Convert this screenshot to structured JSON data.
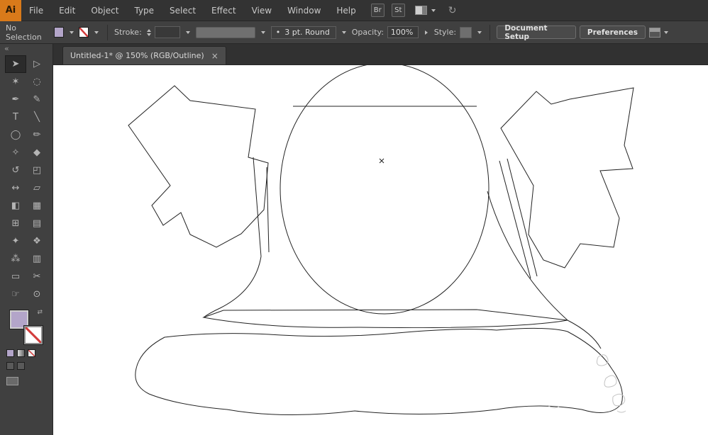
{
  "app": {
    "logo_text": "Ai"
  },
  "menubar": {
    "items": [
      "File",
      "Edit",
      "Object",
      "Type",
      "Select",
      "Effect",
      "View",
      "Window",
      "Help"
    ]
  },
  "topbar": {
    "br_label": "Br",
    "st_label": "St",
    "gesture_glyph": "↻"
  },
  "controlbar": {
    "selection_status": "No Selection",
    "stroke_label": "Stroke:",
    "brush_dot": "•",
    "brush_value": "3 pt. Round",
    "opacity_label": "Opacity:",
    "opacity_value": "100%",
    "style_label": "Style:",
    "document_setup_label": "Document Setup",
    "preferences_label": "Preferences"
  },
  "tabbar": {
    "active_tab": "Untitled-1* @ 150% (RGB/Outline)",
    "close_glyph": "×"
  },
  "toolbar": {
    "collapse_glyph": "«",
    "swap_glyph": "⇄"
  },
  "tools": [
    {
      "name": "selection-tool",
      "glyph": "➤"
    },
    {
      "name": "direct-selection-tool",
      "glyph": "▷"
    },
    {
      "name": "magic-wand-tool",
      "glyph": "✶"
    },
    {
      "name": "lasso-tool",
      "glyph": "◌"
    },
    {
      "name": "pen-tool",
      "glyph": "✒"
    },
    {
      "name": "pencil-tool",
      "glyph": "✎"
    },
    {
      "name": "type-tool",
      "glyph": "T"
    },
    {
      "name": "line-segment-tool",
      "glyph": "╲"
    },
    {
      "name": "ellipse-tool",
      "glyph": "◯"
    },
    {
      "name": "paintbrush-tool",
      "glyph": "✏"
    },
    {
      "name": "shaper-tool",
      "glyph": "✧"
    },
    {
      "name": "eraser-tool",
      "glyph": "◆"
    },
    {
      "name": "rotate-tool",
      "glyph": "↺"
    },
    {
      "name": "scale-tool",
      "glyph": "◰"
    },
    {
      "name": "width-tool",
      "glyph": "↔"
    },
    {
      "name": "free-transform-tool",
      "glyph": "▱"
    },
    {
      "name": "shape-builder-tool",
      "glyph": "◧"
    },
    {
      "name": "perspective-grid-tool",
      "glyph": "▦"
    },
    {
      "name": "mesh-tool",
      "glyph": "⊞"
    },
    {
      "name": "gradient-tool",
      "glyph": "▤"
    },
    {
      "name": "eyedropper-tool",
      "glyph": "✦"
    },
    {
      "name": "blend-tool",
      "glyph": "❖"
    },
    {
      "name": "symbol-sprayer-tool",
      "glyph": "⁂"
    },
    {
      "name": "column-graph-tool",
      "glyph": "▥"
    },
    {
      "name": "artboard-tool",
      "glyph": "▭"
    },
    {
      "name": "slice-tool",
      "glyph": "✂"
    },
    {
      "name": "hand-tool",
      "glyph": "☞"
    },
    {
      "name": "zoom-tool",
      "glyph": "⊙"
    }
  ],
  "colors": {
    "chrome_dark": "#333333",
    "chrome_mid": "#404040",
    "accent_orange": "#d97a1a",
    "fill_swatch": "#b3a5c9",
    "stroke_none_red": "#d23b3b",
    "canvas": "#ffffff",
    "outline_stroke": "#222222"
  }
}
